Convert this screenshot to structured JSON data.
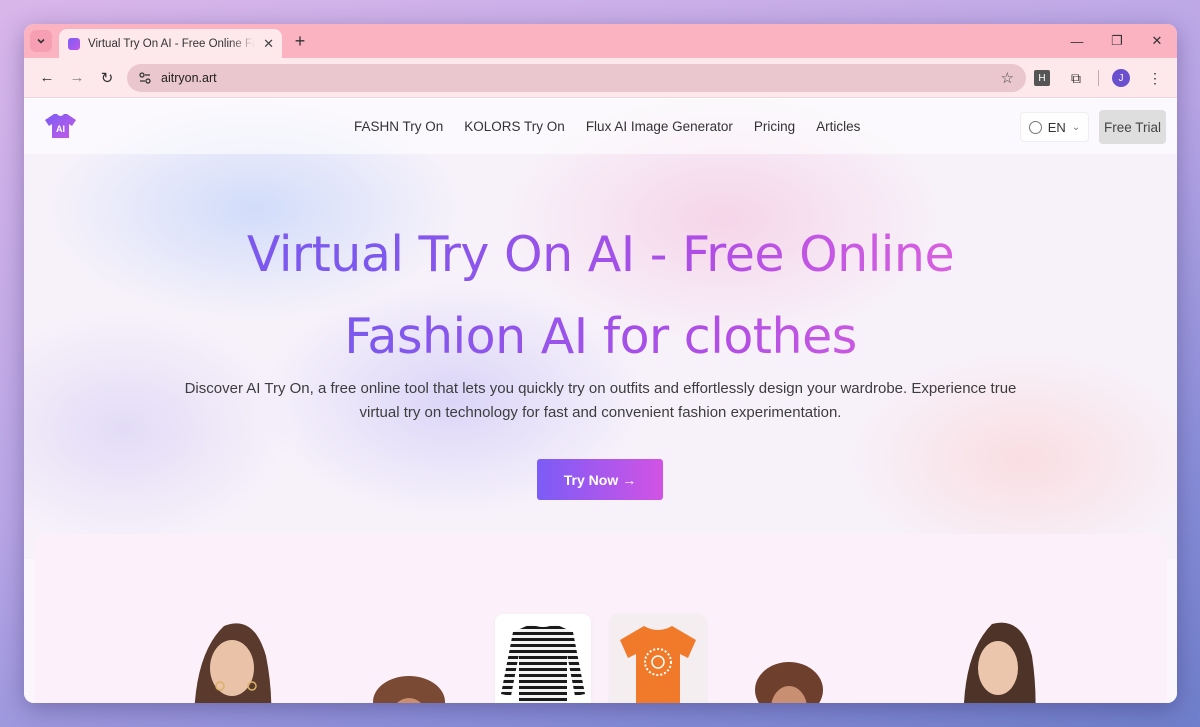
{
  "browser": {
    "tab": {
      "title": "Virtual Try On AI - Free Online Fashion AI for clothes",
      "close": "✕"
    },
    "new_tab": "+",
    "window_controls": {
      "minimize": "—",
      "maximize": "❐",
      "close": "✕"
    },
    "nav": {
      "back": "←",
      "forward": "→",
      "reload": "↻"
    },
    "address": {
      "url": "aitryon.art",
      "star": "☆"
    },
    "extensions": {
      "h_badge": "H",
      "puzzle": "⧉",
      "menu": "⋮"
    },
    "profile": {
      "initial": "J"
    }
  },
  "site": {
    "logo_text": "AI",
    "nav_items": [
      {
        "label": "FASHN Try On"
      },
      {
        "label": "KOLORS Try On"
      },
      {
        "label": "Flux AI Image Generator"
      },
      {
        "label": "Pricing"
      },
      {
        "label": "Articles"
      }
    ],
    "language": {
      "code": "EN",
      "chevron": "⌄"
    },
    "free_trial": "Free Trial"
  },
  "hero": {
    "title_line1": "Virtual Try On AI - Free Online",
    "title_line2": "Fashion AI for clothes",
    "description": "Discover AI Try On, a free online tool that lets you quickly try on outfits and effortlessly design your wardrobe. Experience true virtual try on technology for fast and convenient fashion experimentation.",
    "cta": "Try Now",
    "cta_arrow": "→"
  },
  "colors": {
    "tabstrip": "#fbb3c2",
    "toolbar": "#fde8ec",
    "accent_start": "#7b5cf6",
    "accent_end": "#d253e5"
  }
}
